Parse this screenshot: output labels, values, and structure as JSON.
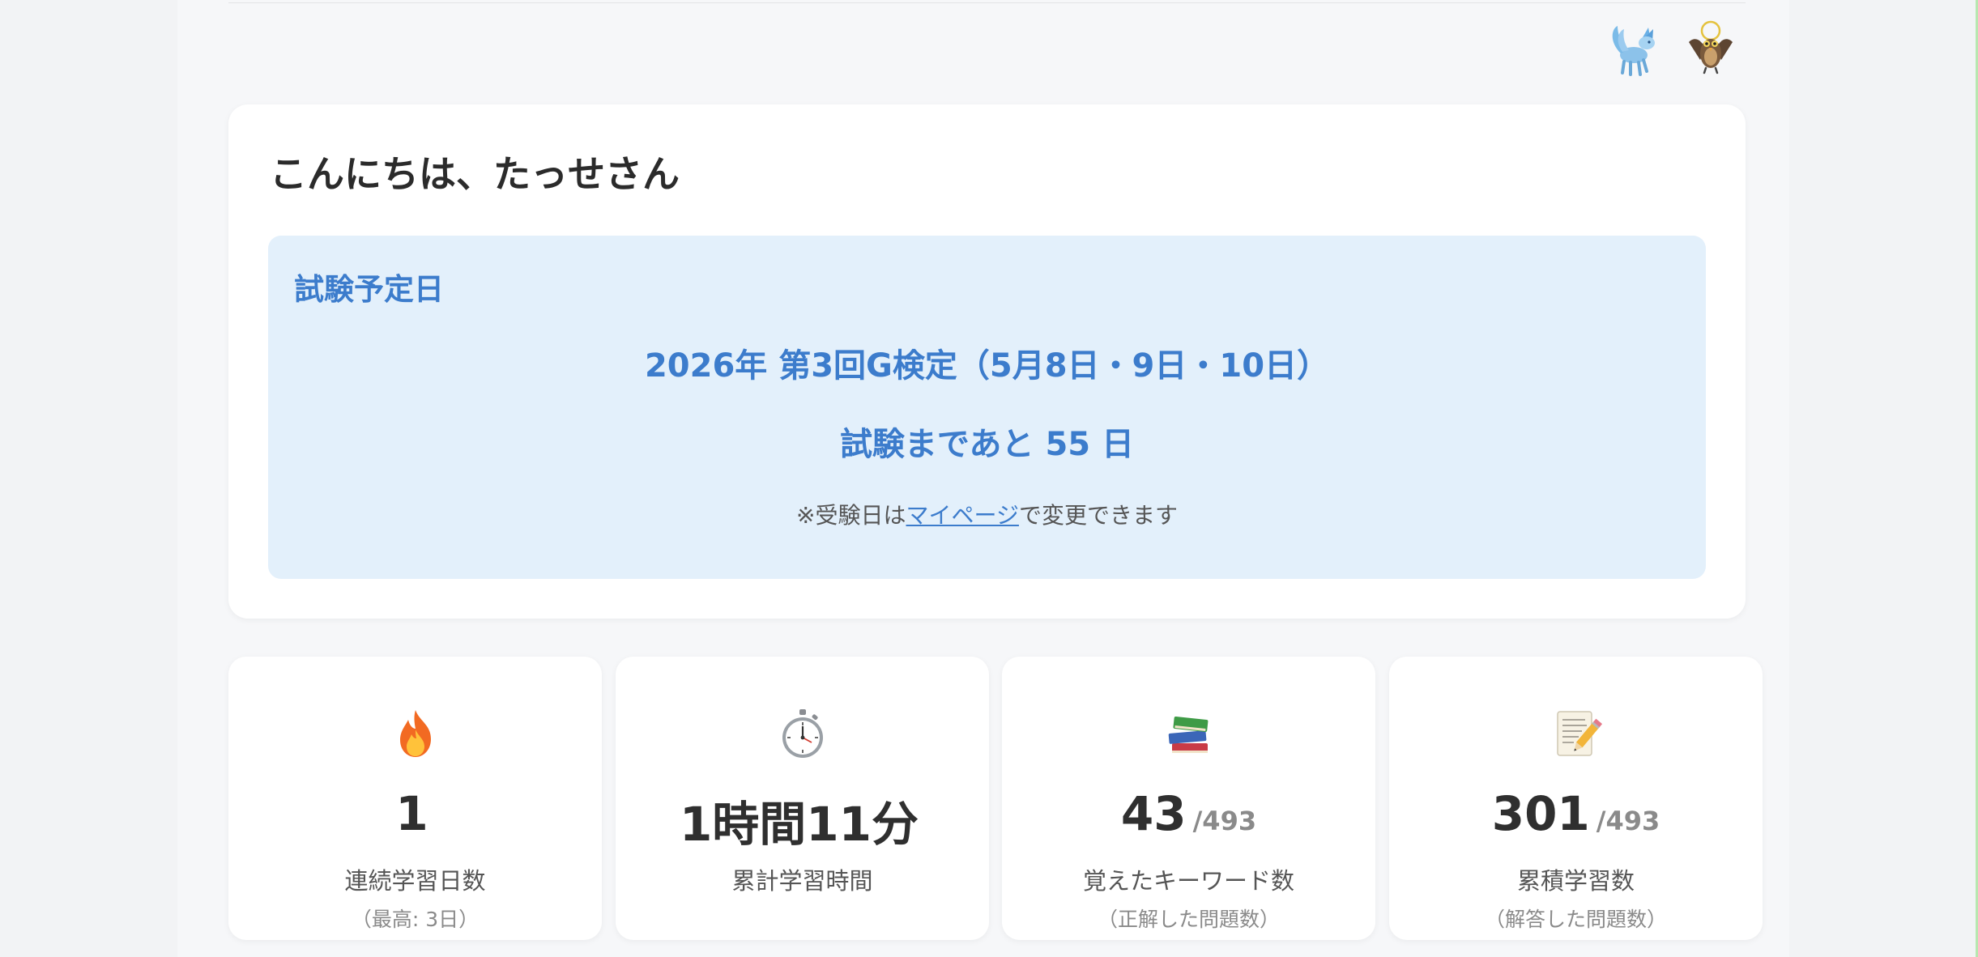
{
  "header": {
    "avatars": [
      {
        "icon": "blue-fox-spirit-icon"
      },
      {
        "icon": "owl-guardian-icon"
      }
    ]
  },
  "welcome": {
    "greeting": "こんにちは、たっせさん"
  },
  "exam": {
    "heading": "試験予定日",
    "name": "2026年 第3回G検定（5月8日・9日・10日）",
    "countdown": "試験まであと 55 日",
    "note_prefix": "※受験日は",
    "note_link": "マイページ",
    "note_suffix": "で変更できます"
  },
  "stats": [
    {
      "icon": "fire-icon",
      "value": "1",
      "total": "",
      "label": "連続学習日数",
      "sub": "（最高: 3日）"
    },
    {
      "icon": "stopwatch-icon",
      "value": "1時間11分",
      "total": "",
      "label": "累計学習時間",
      "sub": ""
    },
    {
      "icon": "books-icon",
      "value": "43",
      "total": "/493",
      "label": "覚えたキーワード数",
      "sub": "（正解した問題数）"
    },
    {
      "icon": "memo-icon",
      "value": "301",
      "total": "/493",
      "label": "累積学習数",
      "sub": "（解答した問題数）"
    }
  ],
  "colors": {
    "accent": "#3c7ccc",
    "exam_background": "#e3f0fb",
    "page_background": "#f6f7f9"
  }
}
